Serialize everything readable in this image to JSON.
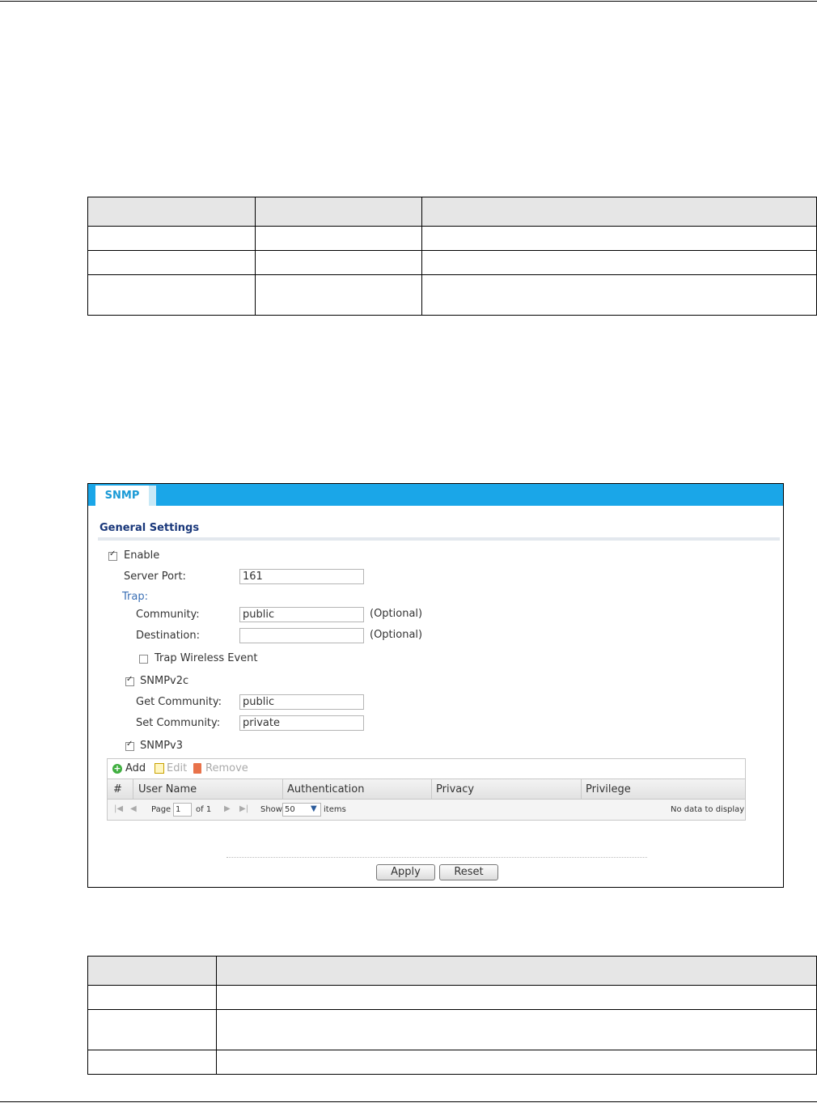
{
  "snmp": {
    "tab_label": "SNMP",
    "section_title": "General Settings",
    "enable_label": "Enable",
    "enable_checked": true,
    "server_port_label": "Server Port:",
    "server_port_value": "161",
    "trap_label": "Trap:",
    "community_label": "Community:",
    "community_value": "public",
    "community_hint": "(Optional)",
    "destination_label": "Destination:",
    "destination_value": "",
    "destination_hint": "(Optional)",
    "trap_wireless_label": "Trap Wireless Event",
    "trap_wireless_checked": false,
    "snmpv2c_label": "SNMPv2c",
    "snmpv2c_checked": true,
    "get_community_label": "Get Community:",
    "get_community_value": "public",
    "set_community_label": "Set Community:",
    "set_community_value": "private",
    "snmpv3_label": "SNMPv3",
    "snmpv3_checked": true,
    "toolbar": {
      "add": "Add",
      "edit": "Edit",
      "remove": "Remove"
    },
    "columns": [
      "#",
      "User Name",
      "Authentication",
      "Privacy",
      "Privilege"
    ],
    "pager": {
      "page_label": "Page",
      "page_value": "1",
      "of_label": "of 1",
      "show_label": "Show",
      "show_value": "50",
      "items_label": "items",
      "empty_text": "No data to display"
    },
    "apply_label": "Apply",
    "reset_label": "Reset"
  }
}
